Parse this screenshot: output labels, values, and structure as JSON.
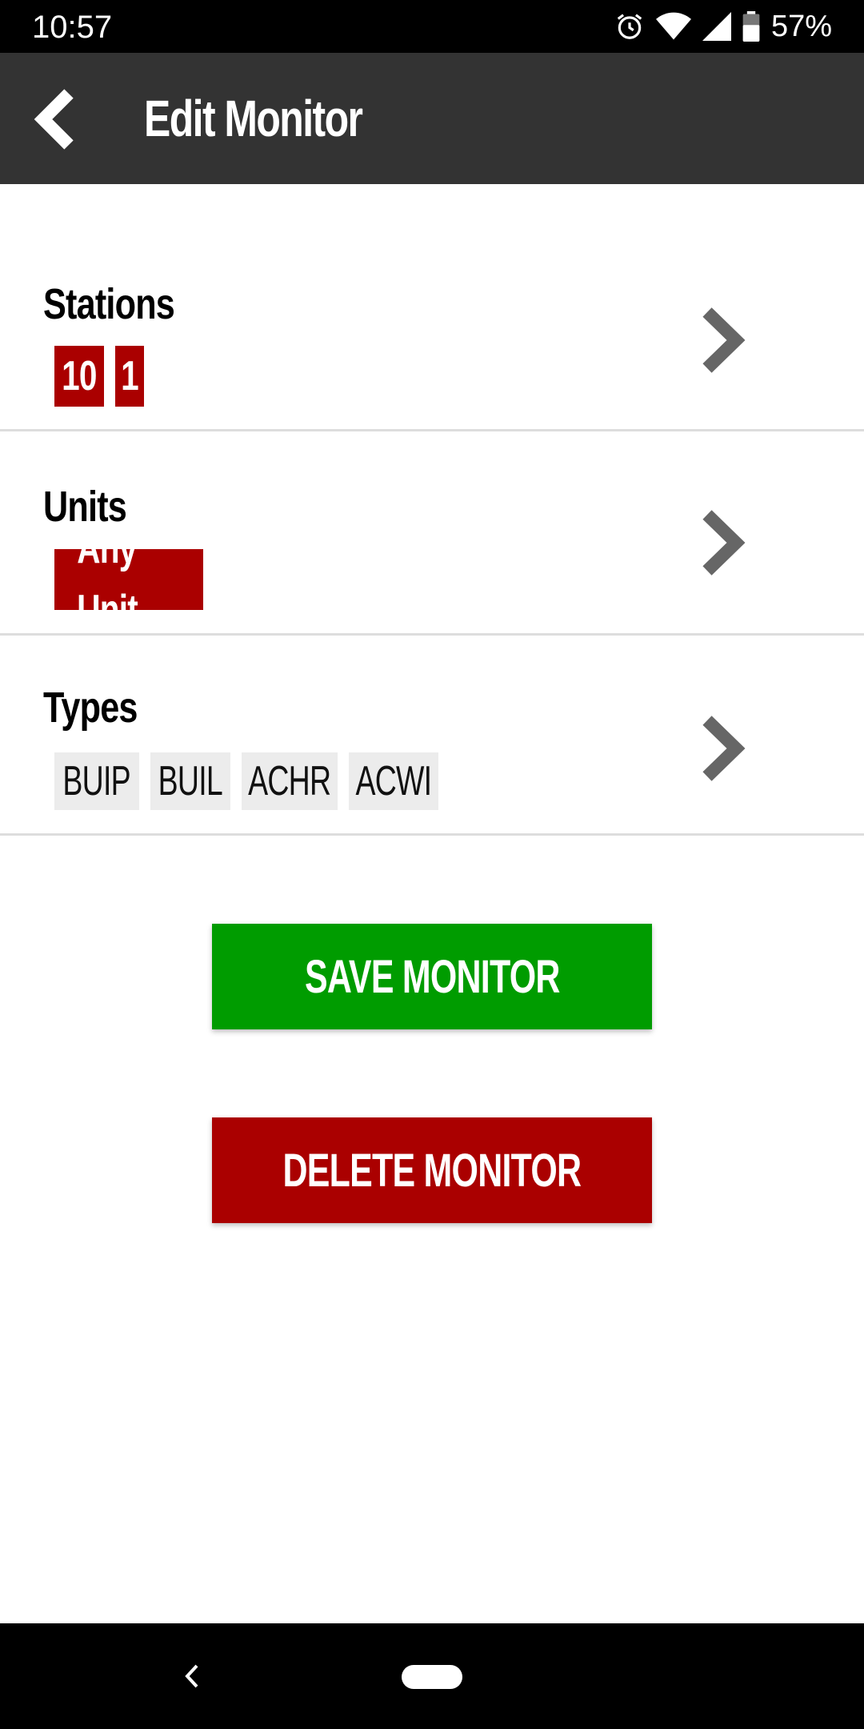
{
  "status_bar": {
    "time": "10:57",
    "battery_percent": "57%",
    "icons": [
      "alarm-icon",
      "wifi-icon",
      "signal-icon",
      "battery-icon"
    ]
  },
  "toolbar": {
    "back_icon": "chevron-left-icon",
    "title": "Edit Monitor"
  },
  "colors": {
    "toolbar_bg": "#333333",
    "accent_red": "#aa0000",
    "save_green": "#009c00",
    "chip_gray": "#ececec",
    "chevron_gray": "#666666"
  },
  "sections": {
    "stations": {
      "label": "Stations",
      "chips": [
        "10",
        "1"
      ]
    },
    "units": {
      "label": "Units",
      "chips": [
        "Any Unit"
      ]
    },
    "types": {
      "label": "Types",
      "chips": [
        "BUIP",
        "BUIL",
        "ACHR",
        "ACWI"
      ]
    }
  },
  "actions": {
    "save_label": "SAVE MONITOR",
    "delete_label": "DELETE MONITOR"
  },
  "nav_bar": {
    "icons": [
      "back-icon",
      "home-pill-icon"
    ]
  }
}
